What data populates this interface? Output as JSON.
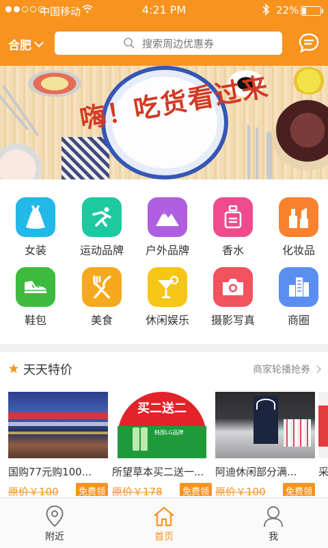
{
  "status_bar": {
    "carrier": "中国移动",
    "time": "4:21 PM",
    "battery": "22%",
    "battery_level": 0.22
  },
  "header": {
    "city": "合肥",
    "search_placeholder": "搜索周边优惠券",
    "icons": [
      "chevron-down-icon",
      "search-icon",
      "message-icon"
    ]
  },
  "banner": {
    "slogan": "嗨！吃货看过来"
  },
  "categories": [
    {
      "label": "女装",
      "icon": "dress-icon",
      "color": "#22b8e8"
    },
    {
      "label": "运动品牌",
      "icon": "runner-icon",
      "color": "#1ec9a0"
    },
    {
      "label": "户外品牌",
      "icon": "mountain-icon",
      "color": "#b05ee0"
    },
    {
      "label": "香水",
      "icon": "perfume-icon",
      "color": "#ee4b8e"
    },
    {
      "label": "化妆品",
      "icon": "cosmetics-icon",
      "color": "#f7822f"
    },
    {
      "label": "鞋包",
      "icon": "shoe-icon",
      "color": "#3dbb3e"
    },
    {
      "label": "美食",
      "icon": "fork-knife-icon",
      "color": "#f7a91e"
    },
    {
      "label": "休闲娱乐",
      "icon": "cocktail-icon",
      "color": "#f5c518"
    },
    {
      "label": "摄影写真",
      "icon": "camera-icon",
      "color": "#f0525e"
    },
    {
      "label": "商圈",
      "icon": "buildings-icon",
      "color": "#5b8ef0"
    }
  ],
  "deals_section": {
    "title": "天天特价",
    "more_label": "商家轮播抢券",
    "items": [
      {
        "name": "国购77元购100...",
        "price": "原价￥100",
        "tag": "免费领"
      },
      {
        "name": "所望草本买二送一...",
        "price": "原价￥178",
        "tag": "免费领"
      },
      {
        "name": "阿迪休闲部分满...",
        "price": "原价￥100",
        "tag": "免费领"
      },
      {
        "name": "采",
        "price": "",
        "tag": ""
      }
    ],
    "promo_image_text": {
      "headline": "买二送二",
      "brand": "韩国LG品牌"
    }
  },
  "tabbar": {
    "tabs": [
      {
        "label": "附近",
        "icon": "location-pin-icon"
      },
      {
        "label": "首页",
        "icon": "home-icon"
      },
      {
        "label": "我",
        "icon": "person-icon"
      }
    ],
    "active": "首页"
  },
  "colors": {
    "accent": "#f7931e",
    "background": "#ffffff",
    "separator": "#efefef"
  }
}
